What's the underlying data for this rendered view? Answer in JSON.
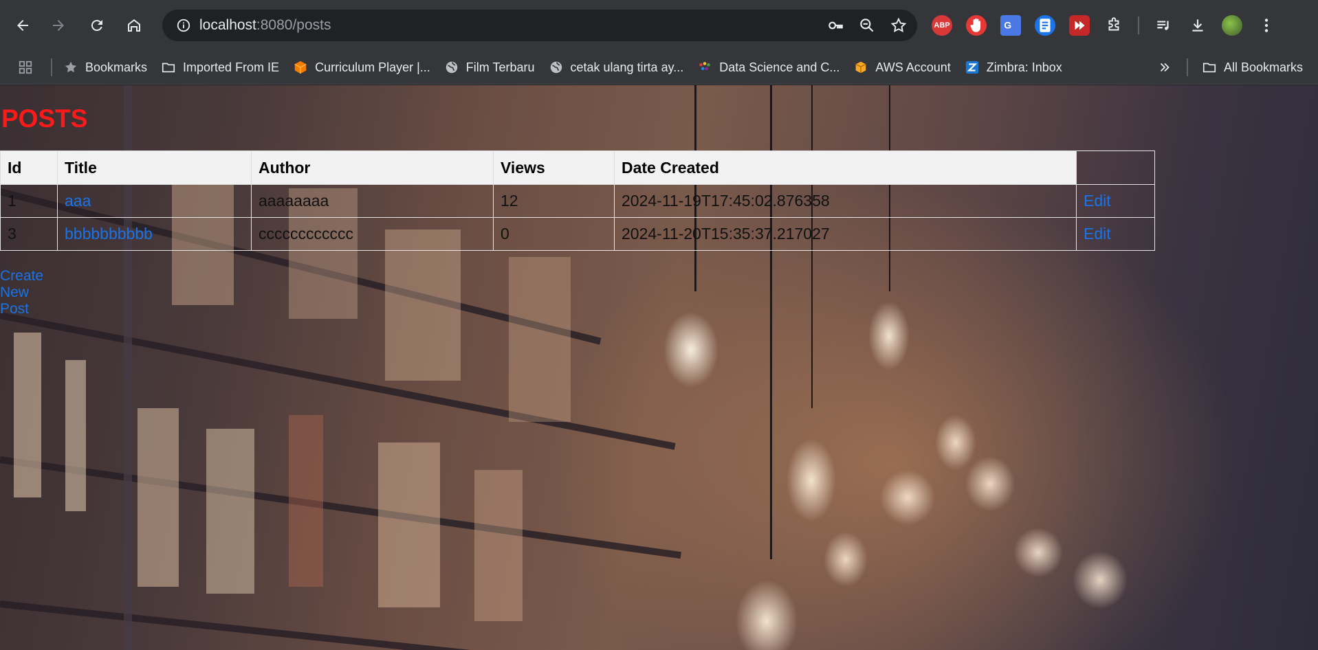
{
  "browser": {
    "url_host": "localhost",
    "url_path": ":8080/posts",
    "bookmarks": [
      {
        "label": "Bookmarks",
        "icon": "star-icon"
      },
      {
        "label": "Imported From IE",
        "icon": "folder-icon"
      },
      {
        "label": "Curriculum Player |...",
        "icon": "cube-icon"
      },
      {
        "label": "Film Terbaru",
        "icon": "globe-icon"
      },
      {
        "label": "cetak ulang tirta ay...",
        "icon": "globe-icon"
      },
      {
        "label": "Data Science and C...",
        "icon": "datasci-icon"
      },
      {
        "label": "AWS Account",
        "icon": "aws-icon"
      },
      {
        "label": "Zimbra: Inbox",
        "icon": "zimbra-icon"
      }
    ],
    "all_bookmarks_label": "All Bookmarks",
    "extensions": {
      "abp": "ABP"
    }
  },
  "page": {
    "title": "POSTS",
    "columns": [
      "Id",
      "Title",
      "Author",
      "Views",
      "Date Created"
    ],
    "rows": [
      {
        "id": "1",
        "title": "aaa",
        "author": "aaaaaaaa",
        "views": "12",
        "date": "2024-11-19T17:45:02.876358",
        "action": "Edit"
      },
      {
        "id": "3",
        "title": "bbbbbbbbbb",
        "author": "cccccccccccc",
        "views": "0",
        "date": "2024-11-20T15:35:37.217027",
        "action": "Edit"
      }
    ],
    "create_link": "Create New Post"
  },
  "colors": {
    "title": "#ff1a1a",
    "link": "#1a73e8",
    "header_bg": "#f2f2f2"
  }
}
